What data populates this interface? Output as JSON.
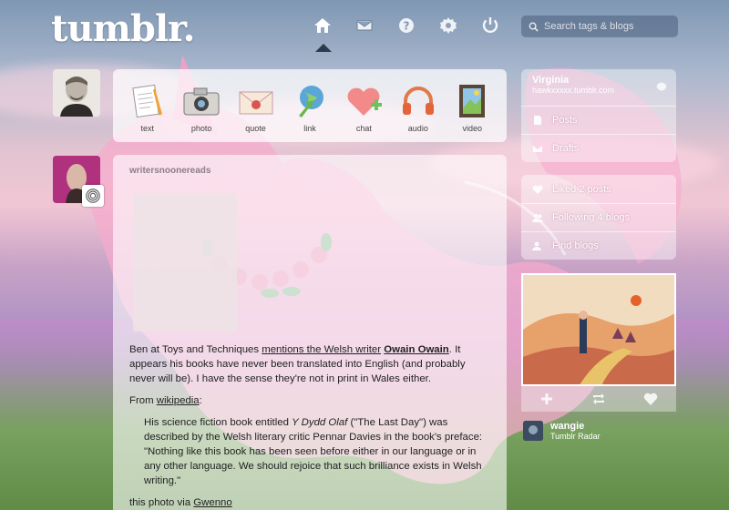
{
  "header": {
    "logo": "tumblr.",
    "search_placeholder": "Search tags & blogs",
    "nav": [
      "home-icon",
      "mail-icon",
      "help-icon",
      "gear-icon",
      "power-icon"
    ]
  },
  "post_types": [
    {
      "label": "text",
      "icon": "text-icon"
    },
    {
      "label": "photo",
      "icon": "camera-icon"
    },
    {
      "label": "quote",
      "icon": "quote-icon"
    },
    {
      "label": "link",
      "icon": "link-icon"
    },
    {
      "label": "chat",
      "icon": "chat-icon"
    },
    {
      "label": "audio",
      "icon": "headphones-icon"
    },
    {
      "label": "video",
      "icon": "film-icon"
    }
  ],
  "post": {
    "author": "writersnoonereads",
    "p1_before": "Ben at Toys and Techniques ",
    "p1_link": "mentions the Welsh writer",
    "p1_space": " ",
    "p1_bold_link": "Owain Owain",
    "p1_after": ". It appears his books have never been translated into English (and probably never will be). I have the sense they're not in print in Wales either.",
    "p2_before": "From ",
    "p2_link": "wikipedia",
    "p2_after": ":",
    "quote_before": "His science fiction book entitled ",
    "quote_title": "Y Dydd Olaf",
    "quote_after": " (\"The Last Day\") was described by the Welsh literary critic Pennar Davies in the book's preface: \"Nothing like this book has been seen before either in our language or in any other language. We should rejoice that such brilliance exists in Welsh writing.\"",
    "p3_before": "this photo via ",
    "p3_link": "Gwenno"
  },
  "sidebar": {
    "blog_name": "Virginia",
    "blog_url": "hawkxxxxx.tumblr.com",
    "blog_rows": [
      {
        "label": "Posts",
        "icon": "document-icon"
      },
      {
        "label": "Drafts",
        "icon": "drafts-icon"
      }
    ],
    "menu_rows": [
      {
        "label": "Liked 2 posts",
        "icon": "heart-icon"
      },
      {
        "label": "Following 4 blogs",
        "icon": "people-icon"
      },
      {
        "label": "Find blogs",
        "icon": "person-add-icon"
      }
    ],
    "radar": {
      "actions": [
        "follow-plus-icon",
        "reblog-icon",
        "like-heart-icon"
      ],
      "user": "wangie",
      "label": "Tumblr Radar"
    }
  }
}
